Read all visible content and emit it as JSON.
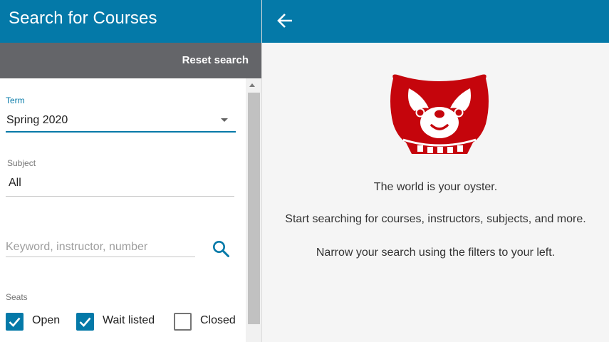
{
  "search_panel": {
    "title": "Search for Courses",
    "reset_label": "Reset search",
    "term": {
      "label": "Term",
      "value": "Spring 2020"
    },
    "subject": {
      "label": "Subject",
      "value": "All"
    },
    "keyword": {
      "placeholder": "Keyword, instructor, number",
      "value": ""
    },
    "seats": {
      "label": "Seats",
      "options": [
        {
          "label": "Open",
          "checked": true
        },
        {
          "label": "Wait listed",
          "checked": true
        },
        {
          "label": "Closed",
          "checked": false
        }
      ]
    }
  },
  "results_panel": {
    "messages": [
      "The world is your oyster.",
      "Start searching for courses, instructors, subjects, and more.",
      "Narrow your search using the filters to your left."
    ]
  },
  "colors": {
    "brand_blue": "#0479a8",
    "toolbar_gray": "#646569",
    "badger_red": "#c5050c"
  },
  "icons": {
    "back": "arrow-left-icon",
    "search": "magnifier-icon",
    "check": "checkmark-icon",
    "logo": "bucky-badger-logo"
  }
}
